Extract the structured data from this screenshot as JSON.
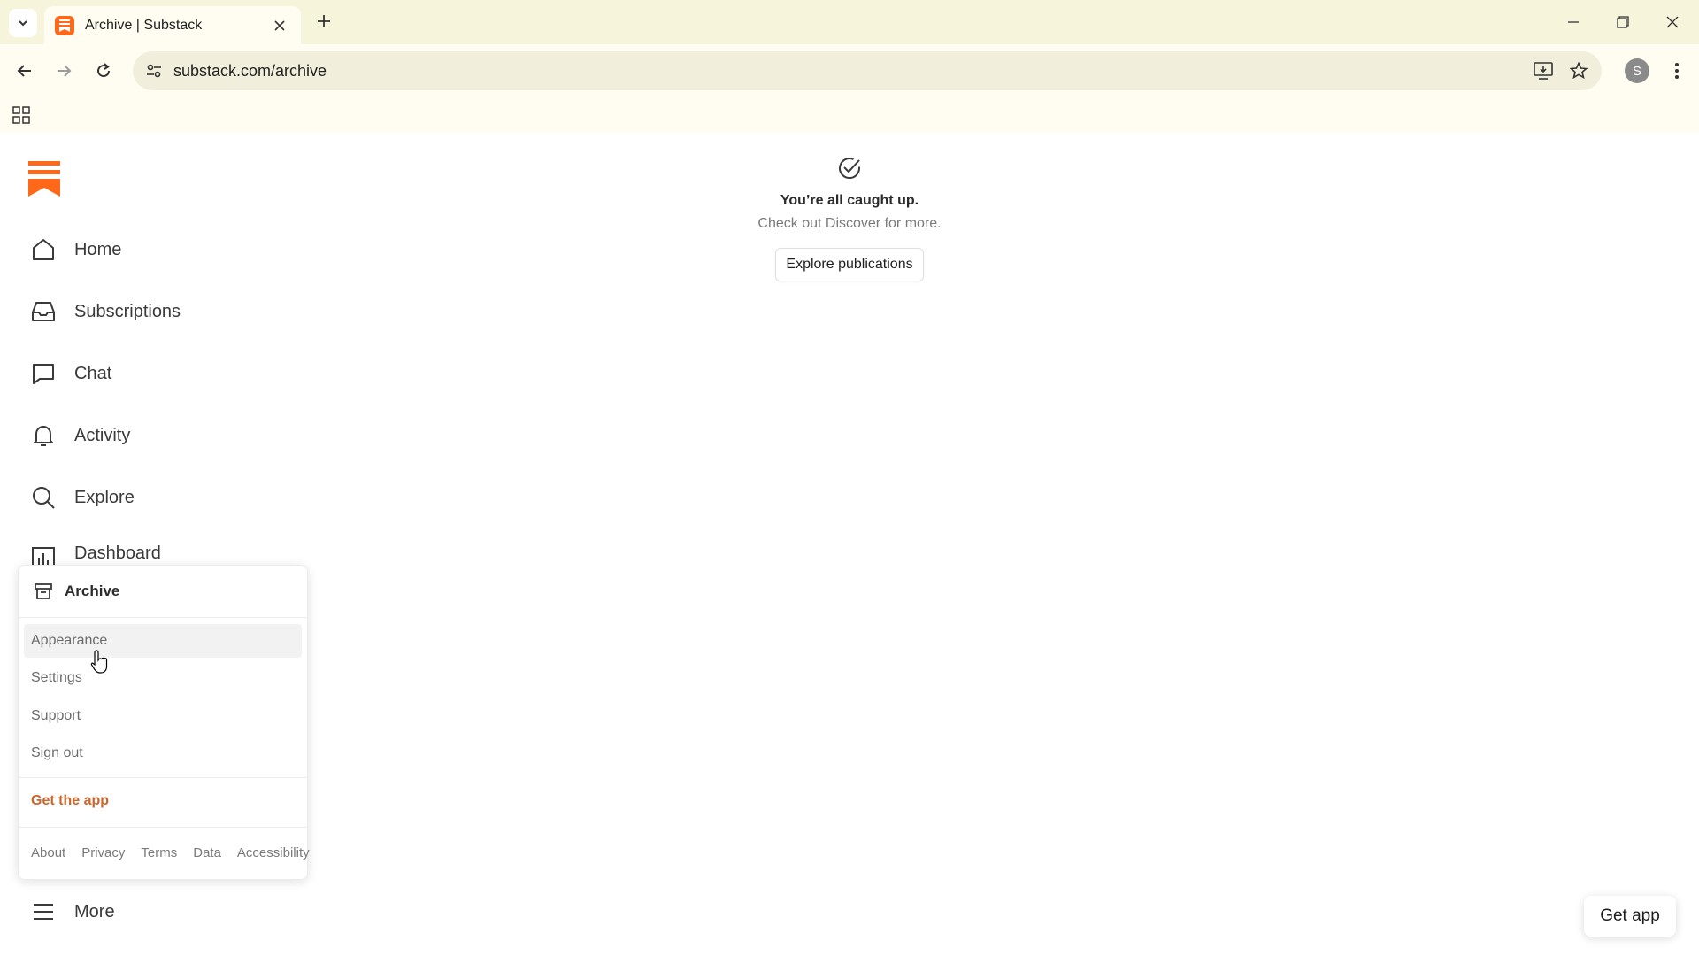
{
  "browser": {
    "tab_title": "Archive | Substack",
    "url": "substack.com/archive",
    "profile_initial": "S"
  },
  "sidebar": {
    "items": [
      {
        "label": "Home",
        "icon": "home-icon"
      },
      {
        "label": "Subscriptions",
        "icon": "inbox-icon"
      },
      {
        "label": "Chat",
        "icon": "chat-icon"
      },
      {
        "label": "Activity",
        "icon": "bell-icon"
      },
      {
        "label": "Explore",
        "icon": "search-icon"
      },
      {
        "label": "Dashboard",
        "icon": "bar-chart-icon"
      }
    ],
    "more_label": "More"
  },
  "dropdown": {
    "archive_label": "Archive",
    "items": [
      "Appearance",
      "Settings",
      "Support",
      "Sign out"
    ],
    "get_app": "Get the app",
    "footer": [
      "About",
      "Privacy",
      "Terms",
      "Data",
      "Accessibility"
    ]
  },
  "empty_state": {
    "title": "You’re all caught up.",
    "subtitle": "Check out Discover for more.",
    "button": "Explore publications"
  },
  "get_app_button": "Get app",
  "colors": {
    "brand": "#ff6719",
    "chrome": "#f7f4dc",
    "link_orange": "#c9672c"
  }
}
